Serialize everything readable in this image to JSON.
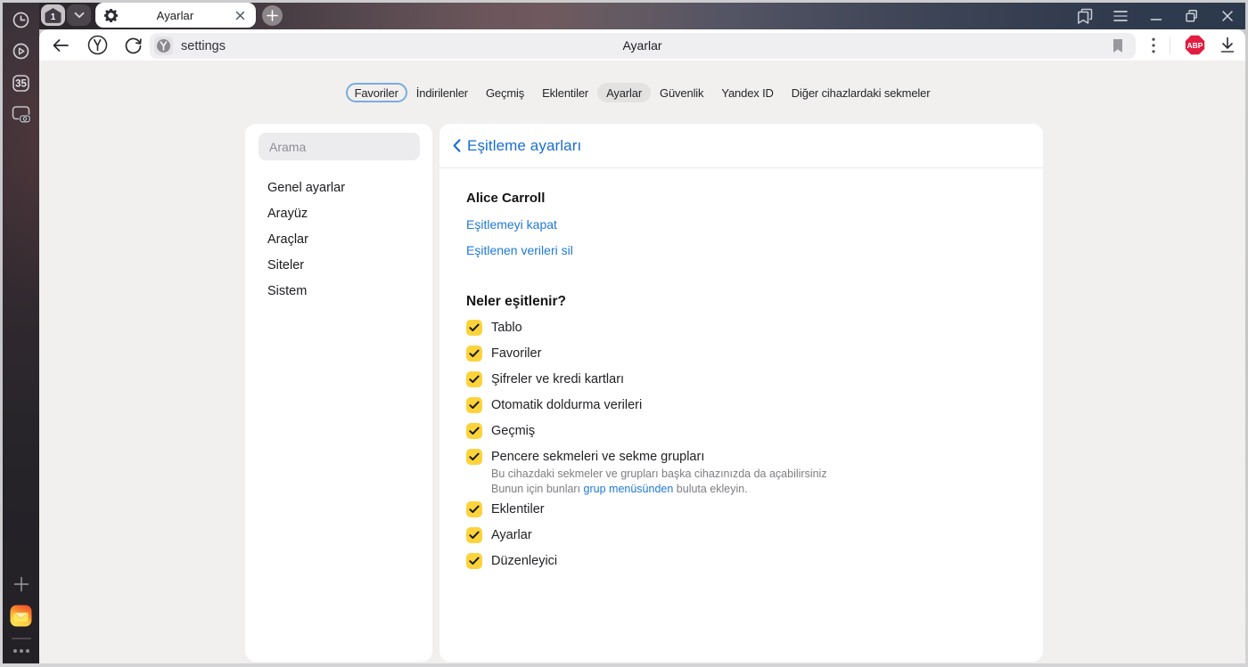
{
  "colors": {
    "accent_blue": "#1a6ed0",
    "link_blue": "#2079d6",
    "checkbox_yellow": "#fcd33b",
    "abp_red": "#e11d41",
    "active_pill_gray": "#e3e2e1",
    "outlined_pill_border": "#7babde"
  },
  "rail": {
    "icons": [
      "history-clock",
      "media-play",
      "tabs-count-badge",
      "screenshot-camera"
    ],
    "tabs_count": "35",
    "bottom_icons": [
      "add-plus",
      "yandex-mail-logo",
      "more-dots"
    ]
  },
  "tabbar": {
    "tab_group_count": "1",
    "active_tab": {
      "title": "Ayarlar",
      "favicon": "gear-icon"
    },
    "window_controls": [
      "side-panel",
      "menu",
      "minimize",
      "restore",
      "close"
    ]
  },
  "toolbar": {
    "url": "settings",
    "page_title": "Ayarlar",
    "abp_badge": "ABP"
  },
  "nav": {
    "items": [
      {
        "label": "Favoriler",
        "outlined": true
      },
      {
        "label": "İndirilenler"
      },
      {
        "label": "Geçmiş"
      },
      {
        "label": "Eklentiler"
      },
      {
        "label": "Ayarlar",
        "active": true
      },
      {
        "label": "Güvenlik"
      },
      {
        "label": "Yandex ID"
      },
      {
        "label": "Diğer cihazlardaki sekmeler"
      }
    ]
  },
  "settings_sidebar": {
    "search_placeholder": "Arama",
    "items": [
      {
        "label": "Genel ayarlar"
      },
      {
        "label": "Arayüz"
      },
      {
        "label": "Araçlar"
      },
      {
        "label": "Siteler"
      },
      {
        "label": "Sistem"
      }
    ]
  },
  "sync_panel": {
    "header_title": "Eşitleme ayarları",
    "account_name": "Alice Carroll",
    "link_disable": "Eşitlemeyi kapat",
    "link_delete": "Eşitlenen verileri sil",
    "section_heading": "Neler eşitlenir?",
    "checkboxes": [
      {
        "label": "Tablo",
        "checked": true
      },
      {
        "label": "Favoriler",
        "checked": true
      },
      {
        "label": "Şifreler ve kredi kartları",
        "checked": true
      },
      {
        "label": "Otomatik doldurma verileri",
        "checked": true
      },
      {
        "label": "Geçmiş",
        "checked": true
      },
      {
        "label": "Pencere sekmeleri ve sekme grupları",
        "checked": true,
        "description": {
          "line1": "Bu cihazdaki sekmeler ve grupları başka cihazınızda da açabilirsiniz",
          "line2_prefix": "Bunun için bunları ",
          "line2_link": "grup menüsünden",
          "line2_suffix": " buluta ekleyin."
        }
      },
      {
        "label": "Eklentiler",
        "checked": true
      },
      {
        "label": "Ayarlar",
        "checked": true
      },
      {
        "label": "Düzenleyici",
        "checked": true
      }
    ]
  }
}
